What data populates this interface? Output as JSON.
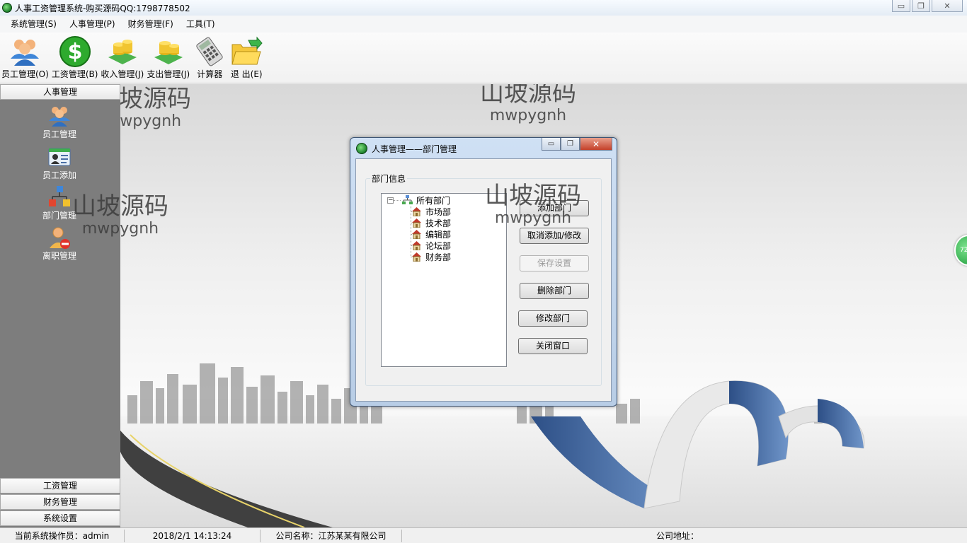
{
  "window": {
    "title": "人事工资管理系统-购买源码QQ:1798778502",
    "controls": {
      "minimize": "▭",
      "maximize": "❐",
      "close": "✕"
    }
  },
  "menubar": {
    "items": [
      {
        "label": "系统管理(S)"
      },
      {
        "label": "人事管理(P)"
      },
      {
        "label": "财务管理(F)"
      },
      {
        "label": "工具(T)"
      }
    ]
  },
  "toolbar": {
    "items": [
      {
        "label": "员工管理(O)",
        "icon": "users-icon"
      },
      {
        "label": "工资管理(B)",
        "icon": "dollar-icon"
      },
      {
        "label": "收入管理(J)",
        "icon": "coins-in-icon"
      },
      {
        "label": "支出管理(J)",
        "icon": "coins-out-icon"
      },
      {
        "label": "计算器",
        "icon": "calculator-icon"
      },
      {
        "label": "退 出(E)",
        "icon": "exit-folder-icon"
      }
    ]
  },
  "sidebar": {
    "top_header": "人事管理",
    "nav_items": [
      {
        "label": "员工管理",
        "icon": "users-icon"
      },
      {
        "label": "员工添加",
        "icon": "id-card-icon"
      },
      {
        "label": "部门管理",
        "icon": "org-chart-icon"
      },
      {
        "label": "离职管理",
        "icon": "user-remove-icon"
      }
    ],
    "bottom_headers": [
      "工资管理",
      "财务管理",
      "系统设置"
    ]
  },
  "watermark": {
    "cn": "山坡源码",
    "en": "mwpygnh"
  },
  "dialog": {
    "title": "人事管理——部门管理",
    "group_label": "部门信息",
    "tree": {
      "root": "所有部门",
      "expander": "−",
      "children": [
        "市场部",
        "技术部",
        "编辑部",
        "论坛部",
        "财务部"
      ]
    },
    "buttons": {
      "add": "添加部门",
      "cancel": "取消添加/修改",
      "save": "保存设置",
      "delete": "删除部门",
      "edit": "修改部门",
      "close": "关闭窗口"
    }
  },
  "statusbar": {
    "operator": "当前系统操作员：admin",
    "datetime": "2018/2/1 14:13:24",
    "company": "公司名称：江苏某某有限公司",
    "address": "公司地址："
  },
  "edge_widget": {
    "text": "72"
  }
}
